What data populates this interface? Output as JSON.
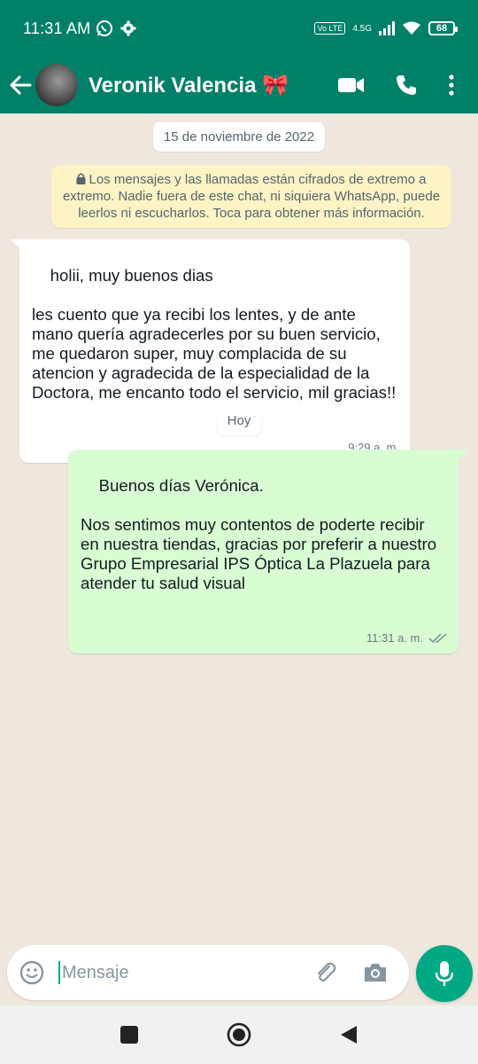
{
  "status_bar": {
    "time": "11:31 AM",
    "network": "4.5G",
    "battery": "68"
  },
  "header": {
    "contact_name": "Veronik Valencia",
    "contact_emoji": "🎀"
  },
  "chat": {
    "date_label": "15 de noviembre de 2022",
    "encryption_notice": "Los mensajes y las llamadas están cifrados de extremo a extremo. Nadie fuera de este chat, ni siquiera WhatsApp, puede leerlos ni escucharlos. Toca para obtener más información.",
    "today_label": "Hoy",
    "messages": [
      {
        "direction": "incoming",
        "text": "holii, muy buenos dias\n\nles cuento que ya recibi los lentes, y de ante mano quería agradecerles por su buen servicio, me quedaron super, muy complacida de su atencion y agradecida de la especialidad de la Doctora, me encanto todo el servicio, mil gracias!!",
        "time": "9:29 a. m."
      },
      {
        "direction": "outgoing",
        "text": "Buenos días Verónica.\n\nNos sentimos muy contentos de poderte recibir en nuestra tiendas, gracias por preferir a nuestro Grupo Empresarial IPS Óptica La Plazuela para atender tu salud visual",
        "time": "11:31 a. m."
      }
    ]
  },
  "composer": {
    "placeholder": "Mensaje"
  },
  "colors": {
    "header": "#008069",
    "outgoing_bubble": "#d9fdd3",
    "accent": "#00a884",
    "notice_bg": "#fdf3c5"
  }
}
